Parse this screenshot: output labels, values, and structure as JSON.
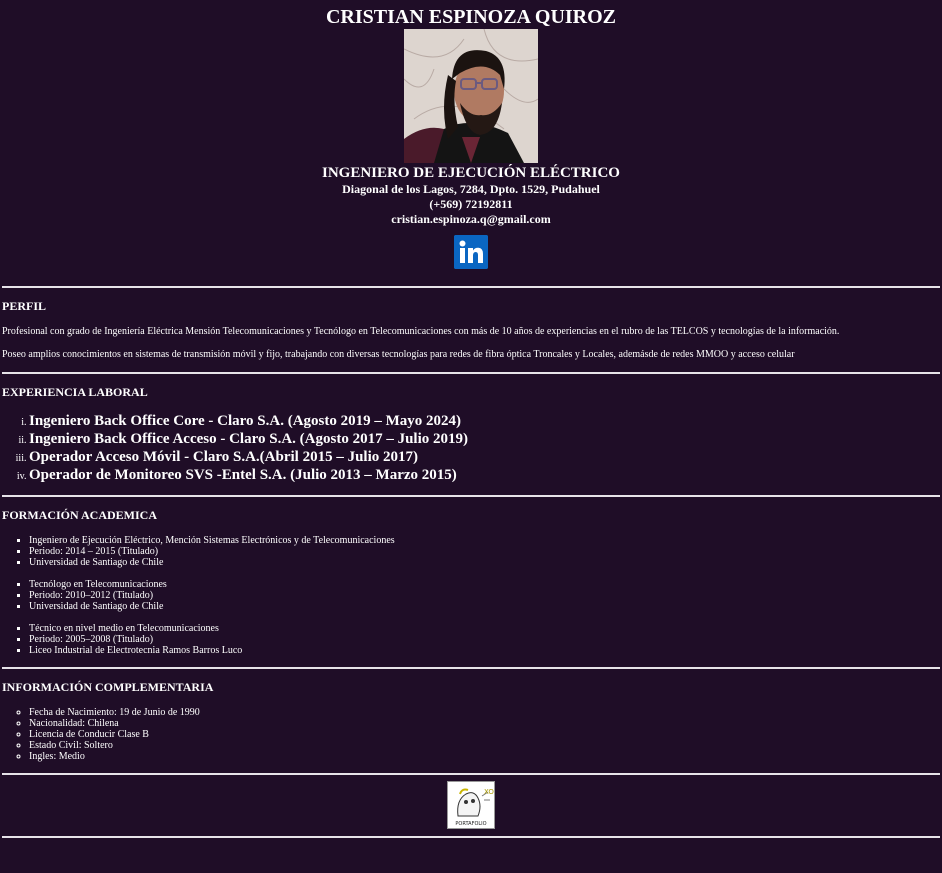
{
  "header": {
    "name": "CRISTIAN ESPINOZA QUIROZ",
    "title": "INGENIERO DE EJECUCIÓN ELÉCTRICO",
    "address": "Diagonal de los Lagos, 7284, Dpto. 1529, Pudahuel",
    "phone": "(+569) 72192811",
    "email": "cristian.espinoza.q@gmail.com"
  },
  "perfil": {
    "heading": "PERFIL",
    "paragraphs": [
      "Profesional con grado de Ingeniería Eléctrica Mensión Telecomunicaciones y Tecnólogo en Telecomunicaciones con más de 10 años de experiencias en el rubro de las TELCOS y tecnologías de la información.",
      "Poseo amplios conocimientos en sistemas de transmisión móvil y fijo, trabajando con diversas tecnologías para redes de fibra óptica Troncales y Locales, ademásde de redes MMOO y acceso celular"
    ]
  },
  "experiencia": {
    "heading": "EXPERIENCIA LABORAL",
    "items": [
      "Ingeniero Back Office Core - Claro S.A. (Agosto 2019 – Mayo 2024)",
      "Ingeniero Back Office Acceso - Claro S.A. (Agosto 2017 – Julio 2019)",
      "Operador Acceso Móvil - Claro S.A.(Abril 2015 – Julio 2017)",
      "Operador de Monitoreo SVS -Entel S.A. (Julio 2013 – Marzo 2015)"
    ]
  },
  "formacion": {
    "heading": "FORMACIÓN ACADEMICA",
    "groups": [
      [
        "Ingeniero de Ejecución Eléctrico, Mención Sistemas Electrónicos y de Telecomunicaciones",
        "Periodo: 2014 – 2015 (Titulado)",
        "Universidad de Santiago de Chile"
      ],
      [
        "Tecnólogo en Telecomunicaciones",
        "Periodo: 2010–2012 (Titulado)",
        "Universidad de Santiago de Chile"
      ],
      [
        "Técnico en nivel medio en Telecomunicaciones",
        "Periodo: 2005–2008 (Titulado)",
        "Liceo Industrial de Electrotecnia Ramos Barros Luco"
      ]
    ]
  },
  "complementaria": {
    "heading": "INFORMACIÓN COMPLEMENTARIA",
    "items": [
      "Fecha de Nacimiento: 19 de Junio de 1990",
      "Nacionalidad: Chilena",
      "Licencia de Conducir Clase B",
      "Estado Civil: Soltero",
      "Ingles: Medio"
    ]
  },
  "icons": {
    "linkedin": "linkedin-icon",
    "portfolio": "portfolio-icon",
    "portfolio_text": "PORTAFOLIO"
  },
  "colors": {
    "background": "#1f0d27",
    "text": "#ffffff",
    "linkedin": "#0a66c2"
  }
}
